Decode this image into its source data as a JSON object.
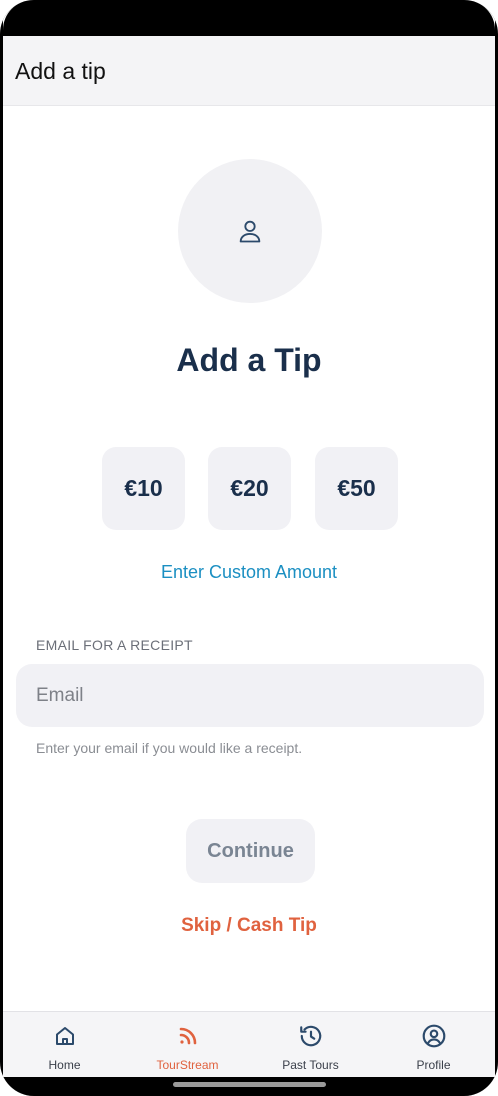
{
  "header": {
    "title": "Add a tip"
  },
  "avatar": {
    "icon": "user-icon"
  },
  "heading": "Add a Tip",
  "amounts": [
    {
      "label": "€10"
    },
    {
      "label": "€20"
    },
    {
      "label": "€50"
    }
  ],
  "custom_amount_label": "Enter Custom Amount",
  "email": {
    "label": "EMAIL FOR A RECEIPT",
    "placeholder": "Email",
    "value": "",
    "help": "Enter your email if you would like a receipt."
  },
  "continue_label": "Continue",
  "skip_label": "Skip / Cash Tip",
  "tabs": [
    {
      "label": "Home",
      "icon": "home-icon",
      "active": false
    },
    {
      "label": "TourStream",
      "icon": "rss-icon",
      "active": true
    },
    {
      "label": "Past Tours",
      "icon": "history-icon",
      "active": false
    },
    {
      "label": "Profile",
      "icon": "profile-icon",
      "active": false
    }
  ],
  "colors": {
    "accent": "#e0623f",
    "link": "#1b8fc2",
    "heading": "#1a2f4b",
    "surface": "#f1f1f5"
  }
}
